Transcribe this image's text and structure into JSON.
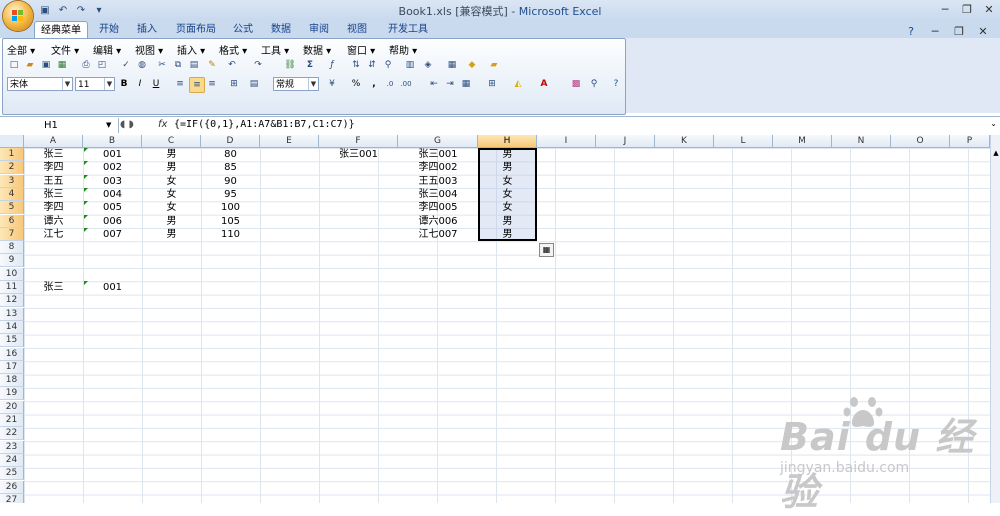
{
  "window": {
    "title": "Book1.xls",
    "mode": "[兼容模式]",
    "app": "Microsoft Excel",
    "qat_icons": [
      "save-icon",
      "undo-icon",
      "redo-icon",
      "customize-icon"
    ]
  },
  "tabs": [
    "经典菜单",
    "开始",
    "插入",
    "页面布局",
    "公式",
    "数据",
    "审阅",
    "视图",
    "开发工具"
  ],
  "menus": [
    "全部 ▾",
    "文件 ▾",
    "编辑 ▾",
    "视图 ▾",
    "插入 ▾",
    "格式 ▾",
    "工具 ▾",
    "数据 ▾",
    "窗口 ▾",
    "帮助 ▾"
  ],
  "toolbar": {
    "font_name": "宋体",
    "font_size": "11",
    "bold": "B",
    "italic": "I",
    "underline": "U",
    "number_format": "常规",
    "currency": "¥",
    "percent": "%",
    "comma": ","
  },
  "formula_bar": {
    "name_box": "H1",
    "fx": "fx",
    "formula": "{=IF({0,1},A1:A7&B1:B7,C1:C7)}"
  },
  "columns": [
    "A",
    "B",
    "C",
    "D",
    "E",
    "F",
    "G",
    "H",
    "I",
    "J",
    "K",
    "L",
    "M",
    "N",
    "O",
    "P"
  ],
  "rows": [
    "1",
    "2",
    "3",
    "4",
    "5",
    "6",
    "7",
    "8",
    "9",
    "10",
    "11",
    "12",
    "13",
    "14",
    "15",
    "16",
    "17",
    "18",
    "19",
    "20",
    "21",
    "22",
    "23",
    "24",
    "25",
    "26",
    "27"
  ],
  "sheet": {
    "A": [
      "张三",
      "李四",
      "王五",
      "张三",
      "李四",
      "谭六",
      "江七"
    ],
    "B": [
      "001",
      "002",
      "003",
      "004",
      "005",
      "006",
      "007"
    ],
    "C": [
      "男",
      "男",
      "女",
      "女",
      "女",
      "男",
      "男"
    ],
    "D": [
      "80",
      "85",
      "90",
      "95",
      "100",
      "105",
      "110"
    ],
    "F1": "张三001",
    "G": [
      "张三001",
      "李四002",
      "王五003",
      "张三004",
      "李四005",
      "谭六006",
      "江七007"
    ],
    "H": [
      "男",
      "男",
      "女",
      "女",
      "女",
      "男",
      "男"
    ],
    "A11": "张三",
    "B11": "001"
  },
  "watermark": {
    "main": "Bai du 经验",
    "sub": "jingyan.baidu.com"
  }
}
